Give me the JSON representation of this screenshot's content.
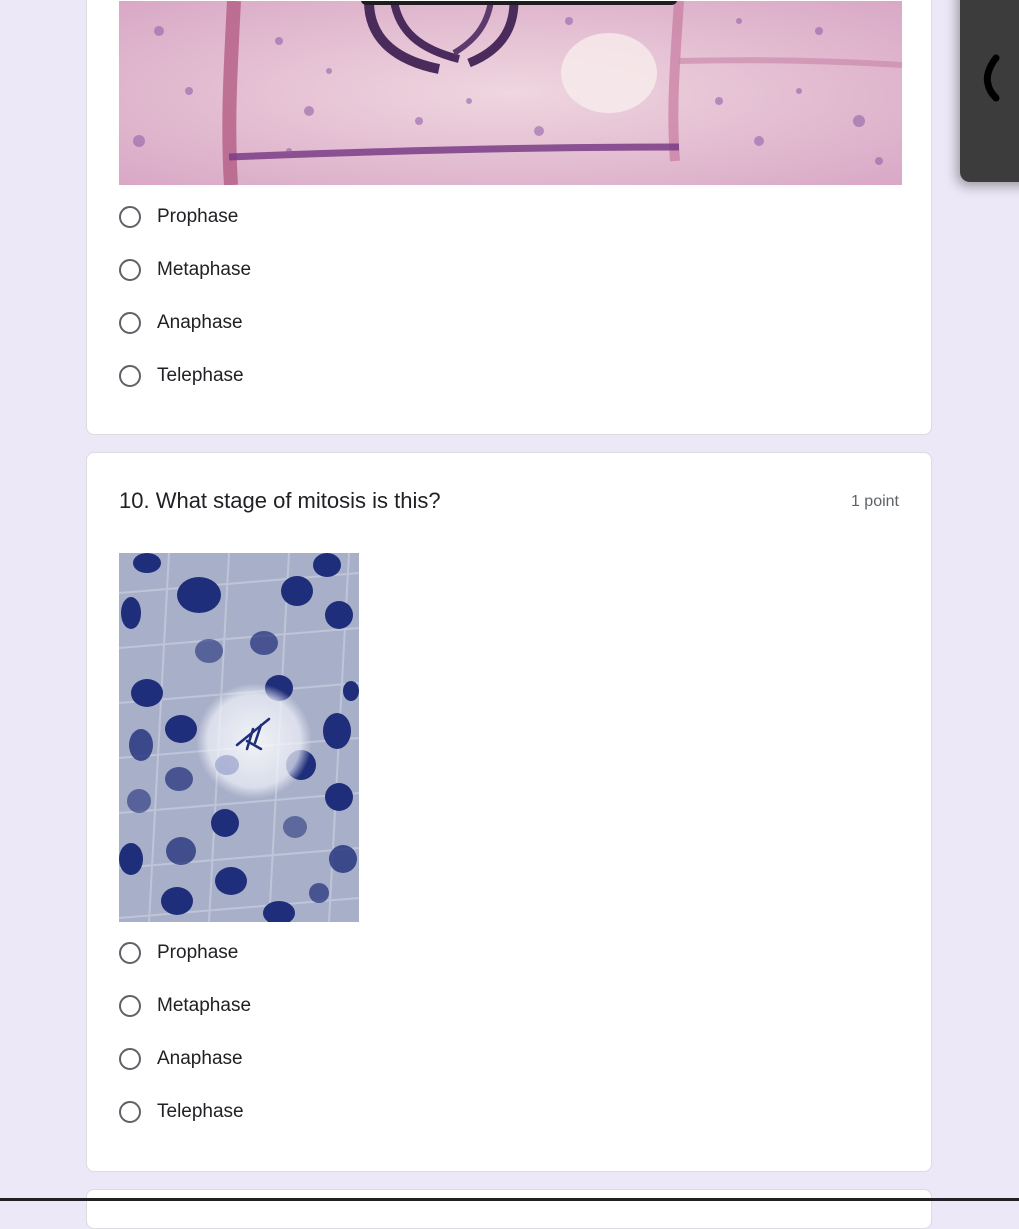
{
  "previous_question": {
    "image_alt": "Micrograph of a dividing plant cell",
    "options": [
      "Prophase",
      "Metaphase",
      "Anaphase",
      "Telephase"
    ]
  },
  "question_10": {
    "title": "10. What stage of mitosis is this?",
    "points": "1 point",
    "image_alt": "Micrograph of onion root tip cells with one highlighted cell",
    "options": [
      "Prophase",
      "Metaphase",
      "Anaphase",
      "Telephase"
    ]
  },
  "side_panel": {
    "icon": "chevron-left-icon"
  },
  "colors": {
    "page_background": "#ece8f7",
    "card_background": "#ffffff",
    "card_border": "#dadce0",
    "radio_border": "#5f6368",
    "side_panel": "#3c3c3c"
  }
}
